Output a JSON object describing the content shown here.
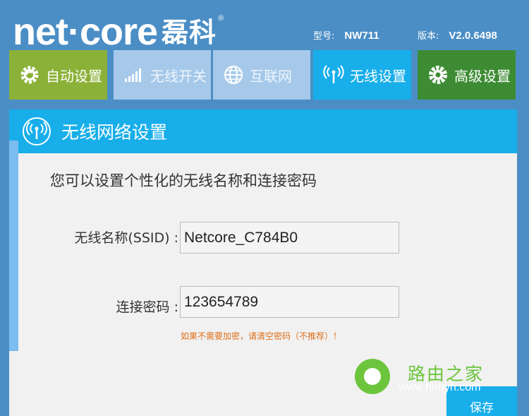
{
  "brand": {
    "logo_text": "net·core",
    "logo_cn": "磊科",
    "registered": "®"
  },
  "device": {
    "model_label": "型号:",
    "model_value": "NW711",
    "version_label": "版本:",
    "version_value": "V2.0.6498"
  },
  "nav": {
    "auto_setup": "自动设置",
    "wireless_switch": "无线开关",
    "internet": "互联网",
    "wireless_settings": "无线设置",
    "advanced": "高级设置"
  },
  "panel": {
    "title": "无线网络设置",
    "description": "您可以设置个性化的无线名称和连接密码",
    "ssid_label": "无线名称(SSID) :",
    "ssid_value": "Netcore_C784B0",
    "password_label": "连接密码 :",
    "password_value": "123654789",
    "warning": "如果不需要加密，请清空密码（不推荐）！",
    "save_label": "保存"
  },
  "watermark": {
    "title": "路由之家",
    "url": "www.hhhyh.com"
  },
  "colors": {
    "background": "#4b8ec5",
    "accent_blue": "#17aeea",
    "green_auto": "#8bb138",
    "green_adv": "#3d8c34",
    "tab_inactive": "#a6c9ea",
    "warning": "#e0701a"
  }
}
